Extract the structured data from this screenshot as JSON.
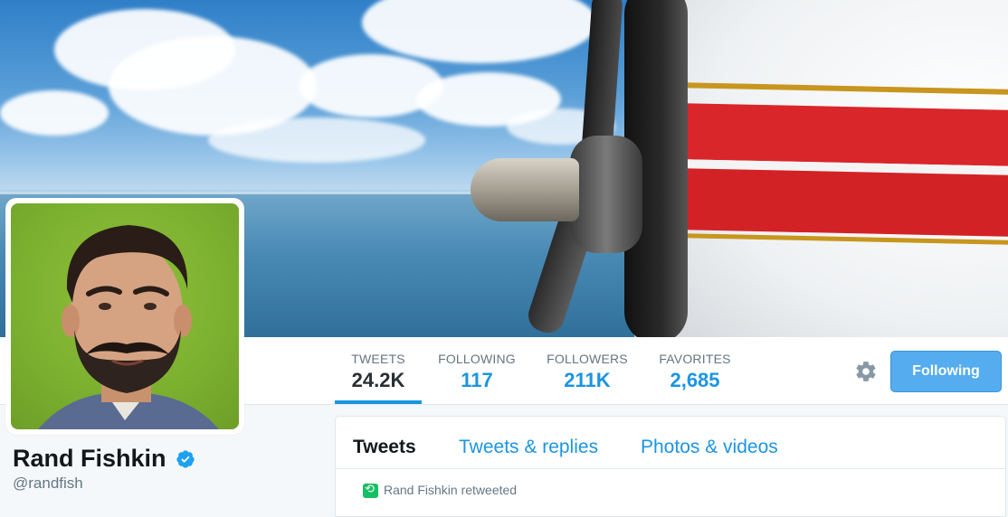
{
  "profile": {
    "name": "Rand Fishkin",
    "screen_name": "@randfish",
    "verified": true
  },
  "stats": [
    {
      "label": "TWEETS",
      "value": "24.2K",
      "active": true
    },
    {
      "label": "FOLLOWING",
      "value": "117",
      "active": false
    },
    {
      "label": "FOLLOWERS",
      "value": "211K",
      "active": false
    },
    {
      "label": "FAVORITES",
      "value": "2,685",
      "active": false
    }
  ],
  "actions": {
    "settings_icon": "gear-icon",
    "follow_button_label": "Following"
  },
  "timeline": {
    "tabs": [
      {
        "label": "Tweets",
        "active": true
      },
      {
        "label": "Tweets & replies",
        "active": false
      },
      {
        "label": "Photos & videos",
        "active": false
      }
    ],
    "retweet_context": "Rand Fishkin retweeted",
    "retweet_icon": "retweet-icon"
  },
  "colors": {
    "accent": "#1b95e0",
    "follow_button": "#55acee",
    "avatar_background": "#7bb02f",
    "verified_badge": "#1da1f2",
    "retweet_green": "#17bf63"
  }
}
